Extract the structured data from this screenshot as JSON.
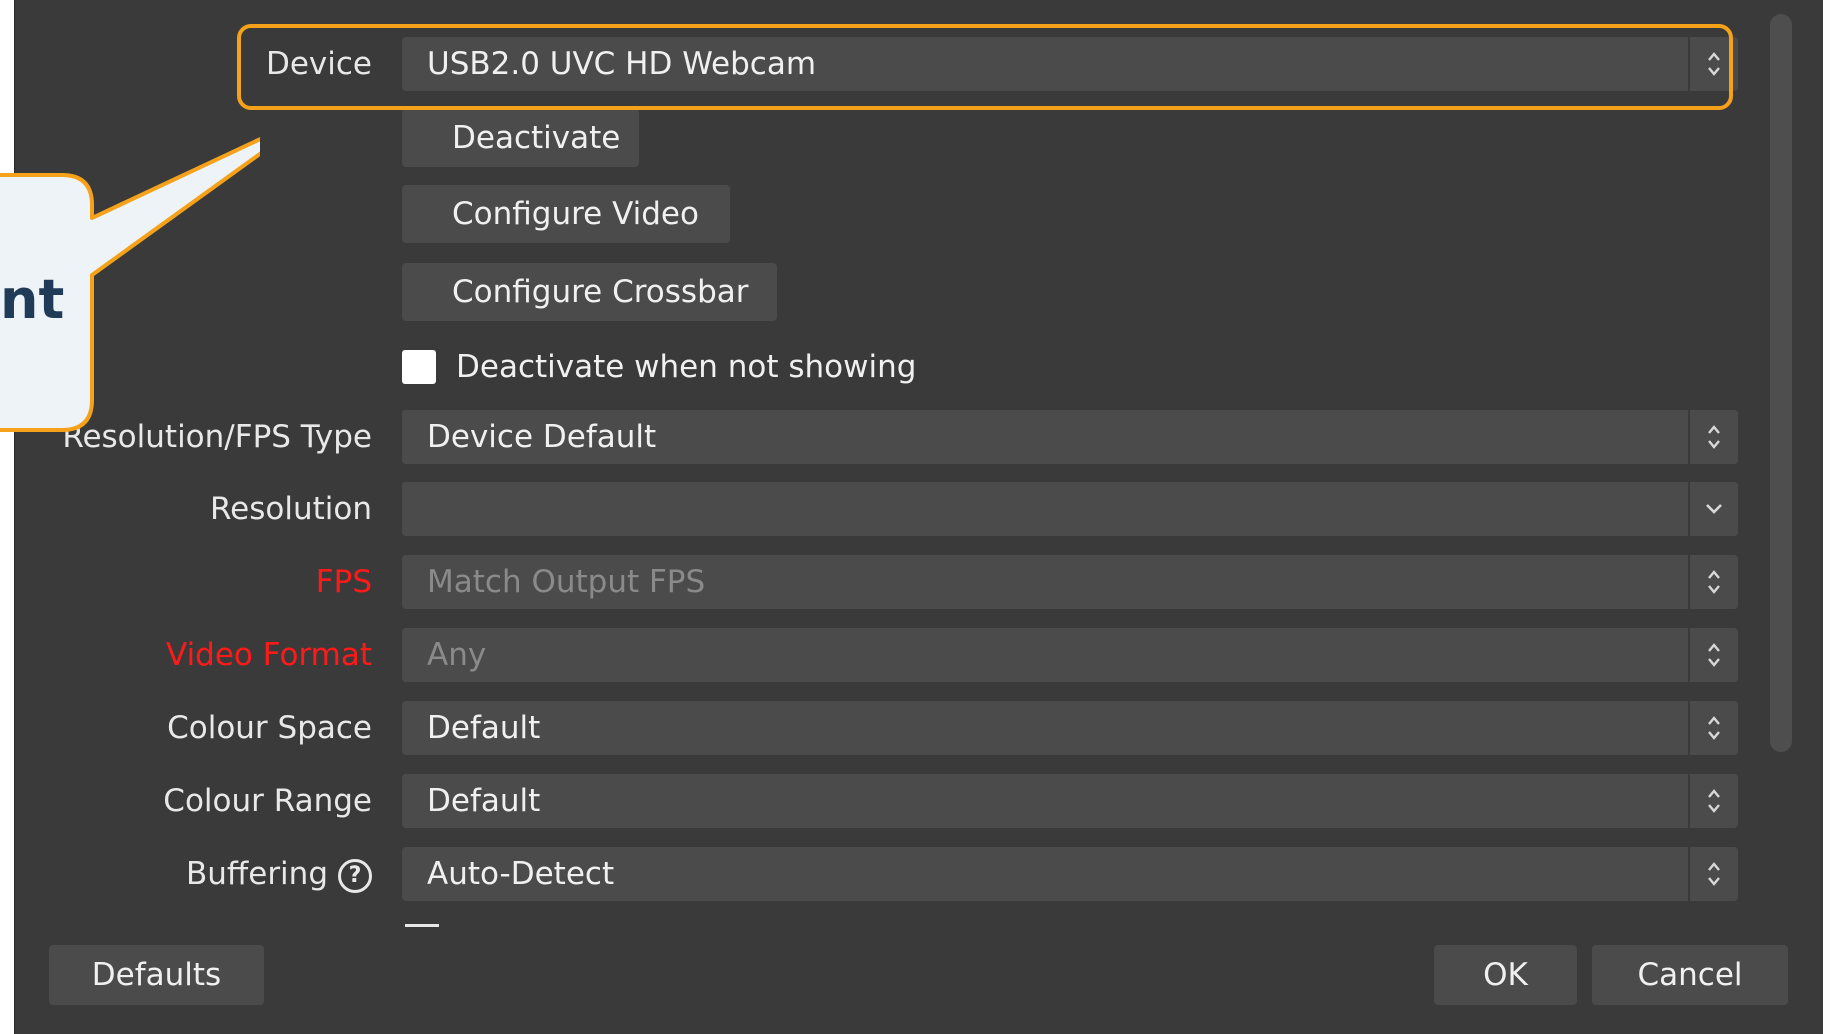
{
  "fields": {
    "device": {
      "label": "Device",
      "value": "USB2.0 UVC HD Webcam"
    },
    "resolution_fps_type": {
      "label": "Resolution/FPS Type",
      "value": "Device Default"
    },
    "resolution": {
      "label": "Resolution",
      "value": ""
    },
    "fps": {
      "label": "FPS",
      "value": "Match Output FPS"
    },
    "video_format": {
      "label": "Video Format",
      "value": "Any"
    },
    "colour_space": {
      "label": "Colour Space",
      "value": "Default"
    },
    "colour_range": {
      "label": "Colour Range",
      "value": "Default"
    },
    "buffering": {
      "label": "Buffering",
      "value": "Auto-Detect",
      "help_icon": "?"
    }
  },
  "buttons": {
    "deactivate": "Deactivate",
    "configure_video": "Configure Video",
    "configure_crossbar": "Configure Crossbar",
    "defaults": "Defaults",
    "ok": "OK",
    "cancel": "Cancel"
  },
  "checkbox": {
    "label": "Deactivate when not showing",
    "checked": false
  },
  "callout": {
    "text": "nt"
  },
  "colors": {
    "highlight": "#f5a21a",
    "panel": "#3a3a3a",
    "control": "#4b4b4b",
    "error_label": "#ff1a1a"
  }
}
